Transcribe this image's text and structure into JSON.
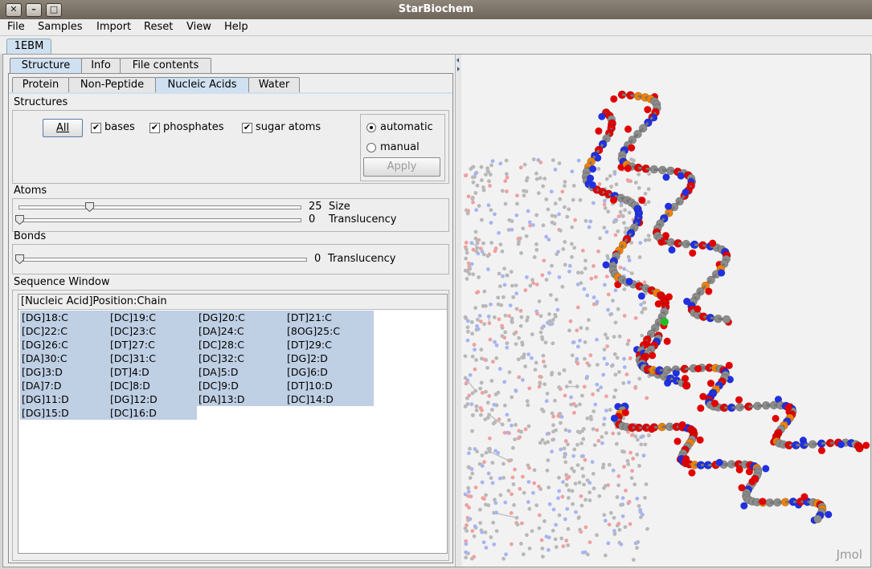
{
  "window": {
    "title": "StarBiochem"
  },
  "menu": [
    "File",
    "Samples",
    "Import",
    "Reset",
    "View",
    "Help"
  ],
  "doc_tab": "1EBM",
  "main_tabs": [
    "Structure",
    "Info",
    "File contents"
  ],
  "sub_tabs": [
    "Protein",
    "Non-Peptide",
    "Nucleic Acids",
    "Water"
  ],
  "structures": {
    "title": "Structures",
    "all_button": "All",
    "checkboxes": [
      {
        "label": "bases",
        "checked": true
      },
      {
        "label": "phosphates",
        "checked": true
      },
      {
        "label": "sugar atoms",
        "checked": true
      }
    ],
    "radio_automatic": "automatic",
    "radio_manual": "manual",
    "apply_button": "Apply"
  },
  "atoms": {
    "title": "Atoms",
    "size_value": "25",
    "size_label": "Size",
    "size_level": 0.25,
    "translucency_value": "0",
    "translucency_label": "Translucency"
  },
  "bonds": {
    "title": "Bonds",
    "translucency_value": "0",
    "translucency_label": "Translucency"
  },
  "sequence": {
    "title": "Sequence Window",
    "header": "[Nucleic Acid]Position:Chain",
    "rows": [
      [
        "[DG]18:C",
        "[DC]19:C",
        "[DG]20:C",
        "[DT]21:C"
      ],
      [
        "[DC]22:C",
        "[DC]23:C",
        "[DA]24:C",
        "[8OG]25:C"
      ],
      [
        "[DG]26:C",
        "[DT]27:C",
        "[DC]28:C",
        "[DT]29:C"
      ],
      [
        "[DA]30:C",
        "[DC]31:C",
        "[DC]32:C",
        "[DG]2:D"
      ],
      [
        "[DG]3:D",
        "[DT]4:D",
        "[DA]5:D",
        "[DG]6:D"
      ],
      [
        "[DA]7:D",
        "[DC]8:D",
        "[DC]9:D",
        "[DT]10:D"
      ],
      [
        "[DG]11:D",
        "[DG]12:D",
        "[DA]13:D",
        "[DC]14:D"
      ],
      [
        "[DG]15:D",
        "[DC]16:D"
      ]
    ]
  },
  "viewer": {
    "watermark": "Jmol"
  },
  "colors": {
    "oxygen": "#e00000",
    "carbon": "#8c8c8c",
    "nitrogen": "#2030e0",
    "phosphorus": "#f08000",
    "selection": "#bfcfe4"
  }
}
